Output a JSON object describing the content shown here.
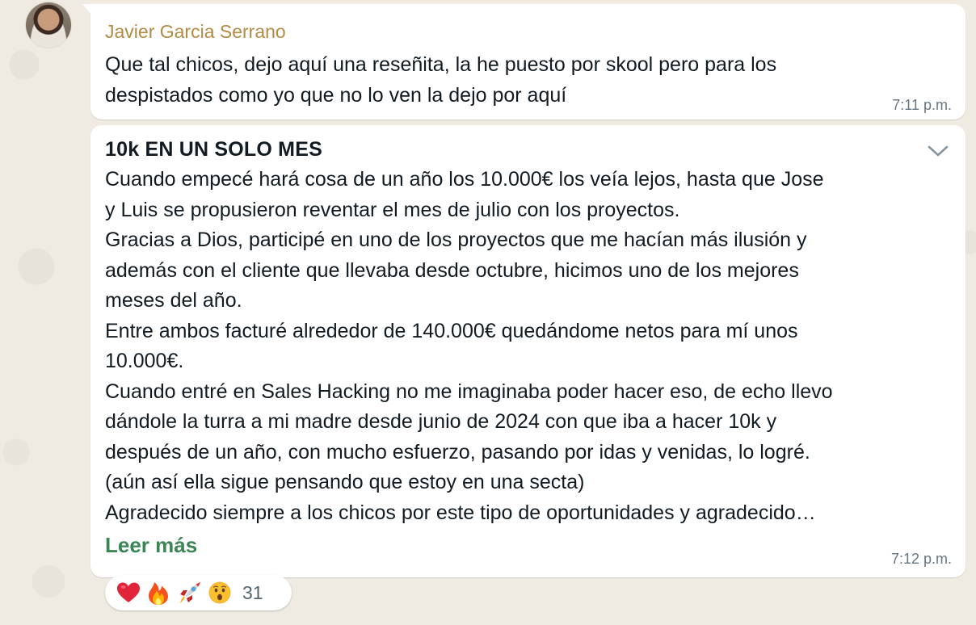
{
  "message1": {
    "sender": "Javier Garcia Serrano",
    "lines": [
      "Que tal chicos, dejo aquí una reseñita, la he puesto por skool pero para los",
      "despistados como yo que no lo ven la dejo por aquí"
    ],
    "time": "7:11 p.m."
  },
  "message2": {
    "title": "10k EN UN SOLO MES",
    "lines": [
      "Cuando empecé hará cosa de un año los 10.000€ los veía lejos, hasta que Jose",
      "y Luis se propusieron reventar el mes de julio con los proyectos.",
      "Gracias a Dios, participé en uno de los proyectos que me hacían más ilusión y",
      "además con el cliente que llevaba desde octubre, hicimos uno de los mejores",
      "meses del año.",
      "Entre ambos facturé alrededor de 140.000€ quedándome netos para mí unos",
      "10.000€.",
      "Cuando entré en Sales Hacking no me imaginaba poder hacer eso, de echo llevo",
      "dándole la turra a mi madre desde junio de 2024 con que iba a hacer 10k y",
      "después de un año, con mucho esfuerzo, pasando por idas y venidas, lo logré.",
      "(aún así ella sigue pensando que estoy en una secta)",
      "Agradecido siempre a los chicos por este tipo de oportunidades y agradecido…"
    ],
    "read_more": "Leer más",
    "time": "7:12 p.m."
  },
  "reactions": {
    "emojis": [
      "red-heart",
      "fire",
      "rocket",
      "astonished-face"
    ],
    "count": "31"
  },
  "colors": {
    "background": "#efeae2",
    "bubble": "#ffffff",
    "sender": "#b58a44",
    "link": "#3b8557",
    "meta": "#667781"
  }
}
